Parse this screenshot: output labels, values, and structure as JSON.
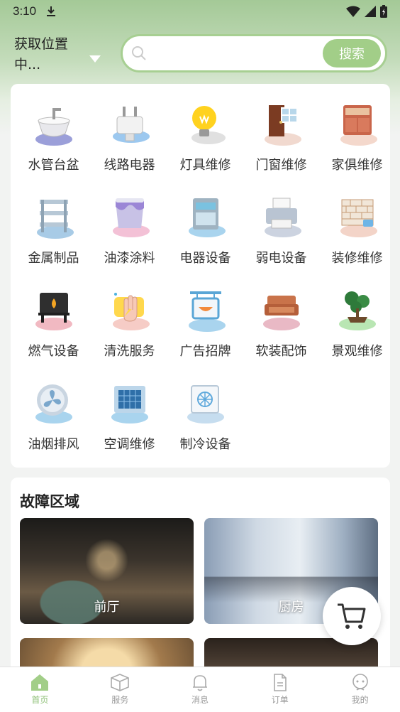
{
  "status_bar": {
    "time": "3:10"
  },
  "header": {
    "location_line1": "获取位置",
    "location_line2": "中...",
    "search_placeholder": "",
    "search_button": "搜索"
  },
  "categories": [
    {
      "label": "水管台盆",
      "icon": "sink-icon"
    },
    {
      "label": "线路电器",
      "icon": "plug-icon"
    },
    {
      "label": "灯具维修",
      "icon": "lightbulb-icon"
    },
    {
      "label": "门窗维修",
      "icon": "door-window-icon"
    },
    {
      "label": "家俱维修",
      "icon": "cabinet-icon"
    },
    {
      "label": "金属制品",
      "icon": "metal-shelf-icon"
    },
    {
      "label": "油漆涂料",
      "icon": "paint-bucket-icon"
    },
    {
      "label": "电器设备",
      "icon": "appliance-icon"
    },
    {
      "label": "弱电设备",
      "icon": "printer-icon"
    },
    {
      "label": "装修维修",
      "icon": "brick-wall-icon"
    },
    {
      "label": "燃气设备",
      "icon": "gas-stove-icon"
    },
    {
      "label": "清洗服务",
      "icon": "cleaning-hand-icon"
    },
    {
      "label": "广告招牌",
      "icon": "signboard-icon"
    },
    {
      "label": "软装配饰",
      "icon": "sofa-icon"
    },
    {
      "label": "景观维修",
      "icon": "bonsai-icon"
    },
    {
      "label": "油烟排风",
      "icon": "exhaust-fan-icon"
    },
    {
      "label": "空调维修",
      "icon": "air-conditioner-icon"
    },
    {
      "label": "制冷设备",
      "icon": "refrigeration-icon"
    }
  ],
  "fault_area": {
    "title": "故障区域",
    "tiles": [
      {
        "label": "前厅"
      },
      {
        "label": "厨房"
      },
      {
        "label": ""
      },
      {
        "label": ""
      }
    ]
  },
  "tabbar": [
    {
      "label": "首页",
      "icon": "home-icon",
      "active": true
    },
    {
      "label": "服务",
      "icon": "box-icon",
      "active": false
    },
    {
      "label": "消息",
      "icon": "bell-icon",
      "active": false
    },
    {
      "label": "订单",
      "icon": "document-icon",
      "active": false
    },
    {
      "label": "我的",
      "icon": "user-icon",
      "active": false
    }
  ],
  "colors": {
    "accent": "#a2ce88",
    "active_tab": "#8fc077"
  }
}
